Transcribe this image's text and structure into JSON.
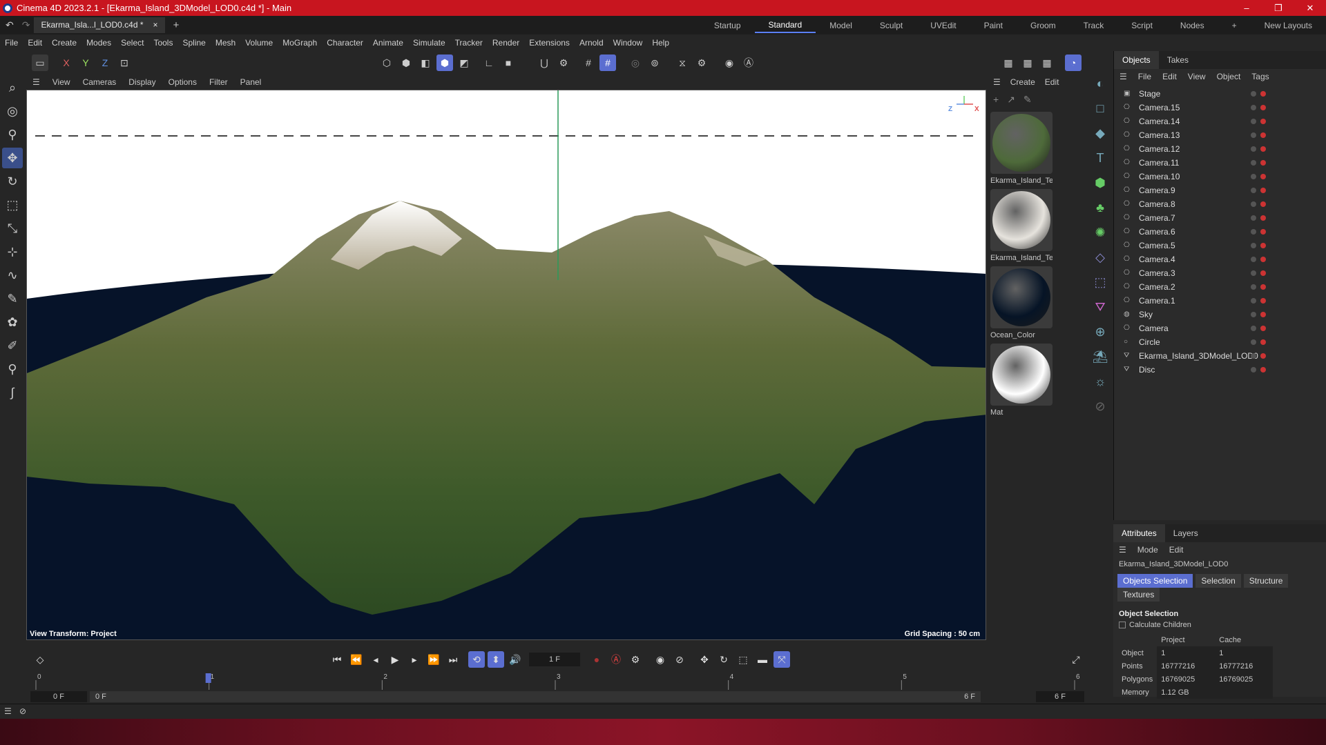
{
  "window": {
    "title": "Cinema 4D 2023.2.1 - [Ekarma_Island_3DModel_LOD0.c4d *] - Main"
  },
  "document_tab": {
    "label": "Ekarma_Isla...l_LOD0.c4d *",
    "close": "×",
    "add": "+"
  },
  "layouts": [
    "Startup",
    "Standard",
    "Model",
    "Sculpt",
    "UVEdit",
    "Paint",
    "Groom",
    "Track",
    "Script",
    "Nodes",
    "+",
    "New Layouts"
  ],
  "active_layout": "Standard",
  "menu": [
    "File",
    "Edit",
    "Create",
    "Modes",
    "Select",
    "Tools",
    "Spline",
    "Mesh",
    "Volume",
    "MoGraph",
    "Character",
    "Animate",
    "Simulate",
    "Tracker",
    "Render",
    "Extensions",
    "Arnold",
    "Window",
    "Help"
  ],
  "axes": [
    "X",
    "Y",
    "Z"
  ],
  "viewport_menu": [
    "View",
    "Cameras",
    "Display",
    "Options",
    "Filter",
    "Panel"
  ],
  "viewport": {
    "view_transform": "View Transform: Project",
    "grid_spacing": "Grid Spacing : 50 cm",
    "axis_z": "Z",
    "axis_x": "X"
  },
  "materials_menu": [
    "Create",
    "Edit"
  ],
  "materials": [
    {
      "name": "Ekarma_Island_Te",
      "color": "#4e6a3a"
    },
    {
      "name": "Ekarma_Island_Te",
      "color": "#e6e3dd"
    },
    {
      "name": "Ocean_Color",
      "color": "#061426"
    },
    {
      "name": "Mat",
      "color": "#ffffff"
    }
  ],
  "objects_panel": {
    "tabs": [
      "Objects",
      "Takes"
    ],
    "menu": [
      "File",
      "Edit",
      "View",
      "Object",
      "Tags"
    ],
    "items": [
      "Stage",
      "Camera.15",
      "Camera.14",
      "Camera.13",
      "Camera.12",
      "Camera.11",
      "Camera.10",
      "Camera.9",
      "Camera.8",
      "Camera.7",
      "Camera.6",
      "Camera.5",
      "Camera.4",
      "Camera.3",
      "Camera.2",
      "Camera.1",
      "Sky",
      "Camera",
      "Circle",
      "Ekarma_Island_3DModel_LOD0",
      "Disc"
    ]
  },
  "attributes": {
    "tabs": [
      "Attributes",
      "Layers"
    ],
    "menu": [
      "Mode",
      "Edit"
    ],
    "object_name": "Ekarma_Island_3DModel_LOD0",
    "buttons": [
      "Objects Selection",
      "Selection",
      "Structure",
      "Textures"
    ],
    "section": "Object Selection",
    "checkbox": "Calculate Children",
    "col_project": "Project",
    "col_cache": "Cache",
    "rows": [
      {
        "label": "Object",
        "project": "1",
        "cache": "1"
      },
      {
        "label": "Points",
        "project": "16777216",
        "cache": "16777216"
      },
      {
        "label": "Polygons",
        "project": "16769025",
        "cache": "16769025"
      },
      {
        "label": "Memory",
        "project": "1.12 GB",
        "cache": ""
      }
    ]
  },
  "timeline": {
    "current_frame": "1 F",
    "start": "0 F",
    "start2": "0 F",
    "end": "6 F",
    "end2": "6 F",
    "ticks": [
      "0",
      "1",
      "2",
      "3",
      "4",
      "5",
      "6"
    ],
    "playhead_frame": 1
  }
}
